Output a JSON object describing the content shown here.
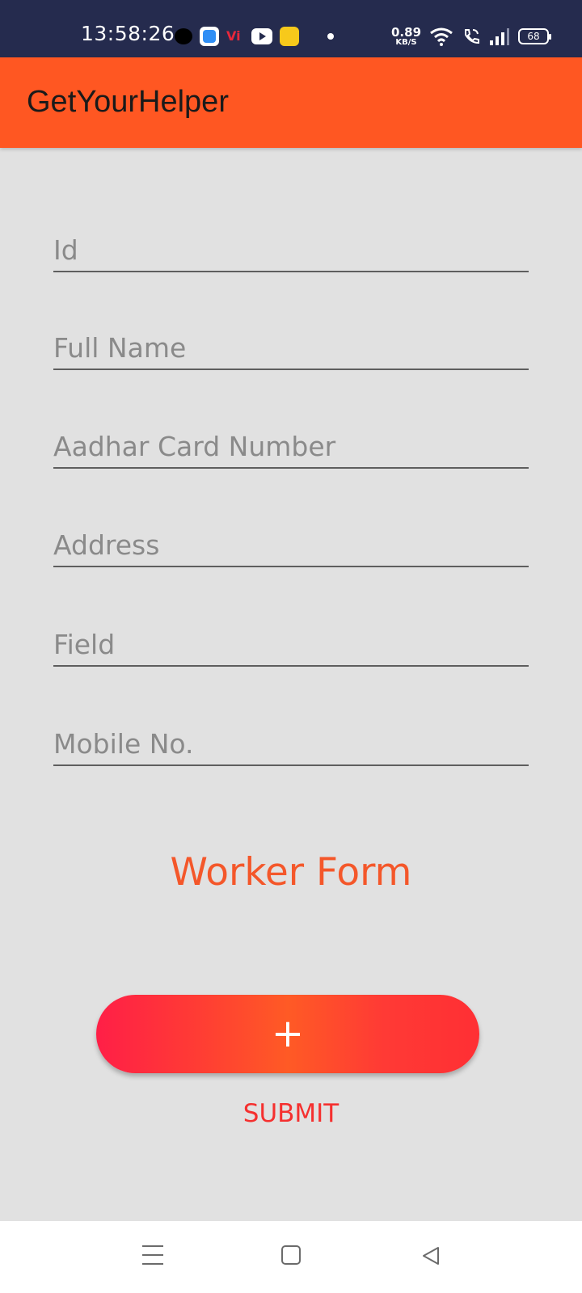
{
  "status_bar": {
    "time": "13:58:26",
    "network_speed_value": "0.89",
    "network_speed_unit": "KB/S",
    "battery_level": "68",
    "vi_label": "Vi"
  },
  "app_bar": {
    "title": "GetYourHelper",
    "color": "#ff5722"
  },
  "form": {
    "fields": [
      {
        "placeholder": "Id",
        "value": ""
      },
      {
        "placeholder": "Full Name",
        "value": ""
      },
      {
        "placeholder": "Aadhar Card Number",
        "value": ""
      },
      {
        "placeholder": "Address",
        "value": ""
      },
      {
        "placeholder": "Field",
        "value": ""
      },
      {
        "placeholder": "Mobile No.",
        "value": ""
      }
    ],
    "title": "Worker Form",
    "fab_label": "+",
    "submit_label": "SUBMIT"
  },
  "icons": {
    "fab": "plus-icon",
    "nav_menu": "menu-icon",
    "nav_home": "home-icon",
    "nav_back": "back-icon"
  }
}
